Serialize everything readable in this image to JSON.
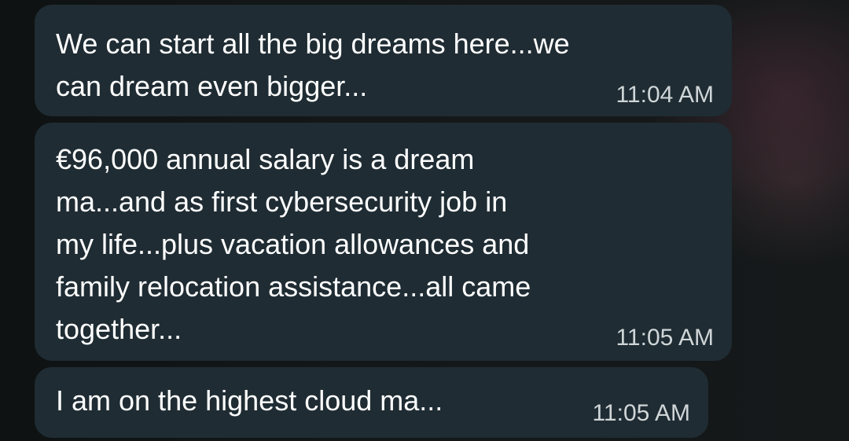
{
  "messages": [
    {
      "text": "We can start all the big dreams here...we\ncan dream even bigger...",
      "time": "11:04 AM"
    },
    {
      "text": "€96,000 annual salary is a dream\nma...and as first cybersecurity job in\nmy life...plus vacation allowances and\nfamily relocation assistance...all came\ntogether...",
      "time": "11:05 AM"
    },
    {
      "text": "I am on the highest cloud ma...",
      "time": "11:05 AM"
    }
  ],
  "colors": {
    "bubble": "#1f2c33",
    "text": "#ffffff",
    "timestamp": "#d0d6d8"
  }
}
